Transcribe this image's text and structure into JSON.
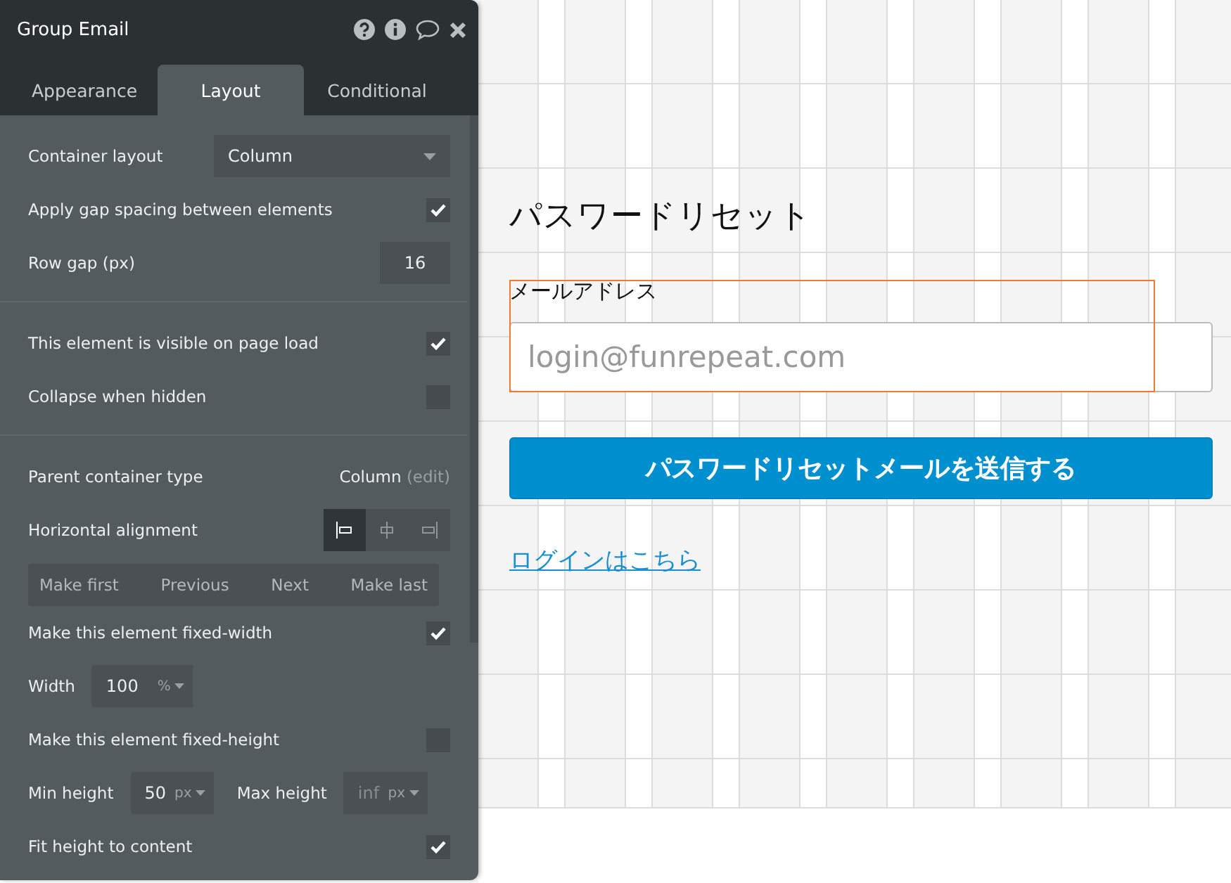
{
  "panel": {
    "title": "Group Email",
    "tabs": [
      {
        "label": "Appearance",
        "selected": false
      },
      {
        "label": "Layout",
        "selected": true
      },
      {
        "label": "Conditional",
        "selected": false
      }
    ],
    "sections": [
      [
        {
          "kind": "select",
          "label": "Container layout",
          "value": "Column"
        },
        {
          "kind": "checkbox",
          "label": "Apply gap spacing between elements",
          "checked": true
        },
        {
          "kind": "number",
          "label": "Row gap (px)",
          "value": "16"
        }
      ],
      [
        {
          "kind": "checkbox",
          "label": "This element is visible on page load",
          "checked": true
        },
        {
          "kind": "checkbox",
          "label": "Collapse when hidden",
          "checked": false
        }
      ],
      [
        {
          "kind": "info",
          "label": "Parent container type",
          "value": "Column",
          "link": "(edit)"
        },
        {
          "kind": "alignment",
          "label": "Horizontal alignment",
          "options": [
            {
              "selected": true
            },
            {
              "selected": false
            },
            {
              "selected": false
            }
          ]
        },
        {
          "kind": "reorder",
          "buttons": [
            "Make first",
            "Previous",
            "Next",
            "Make last"
          ]
        },
        {
          "kind": "checkbox",
          "label": "Make this element fixed-width",
          "checked": true
        },
        {
          "kind": "unit",
          "fields": [
            {
              "label": "Width",
              "value": "100",
              "unit": "%"
            }
          ]
        },
        {
          "kind": "checkbox",
          "label": "Make this element fixed-height",
          "checked": false
        },
        {
          "kind": "unit",
          "fields": [
            {
              "label": "Min height",
              "value": "50",
              "unit": "px"
            },
            {
              "label": "Max height",
              "placeholder": "inf",
              "unit": "px"
            }
          ]
        },
        {
          "kind": "checkbox",
          "label": "Fit height to content",
          "checked": true
        }
      ]
    ]
  },
  "canvas": {
    "heading": "パスワードリセット",
    "email_label": "メールアドレス",
    "email_field": {
      "placeholder": "login@funrepeat.com"
    },
    "submit_button": "パスワードリセットメールを送信する",
    "login_link": "ログインはこちら"
  }
}
